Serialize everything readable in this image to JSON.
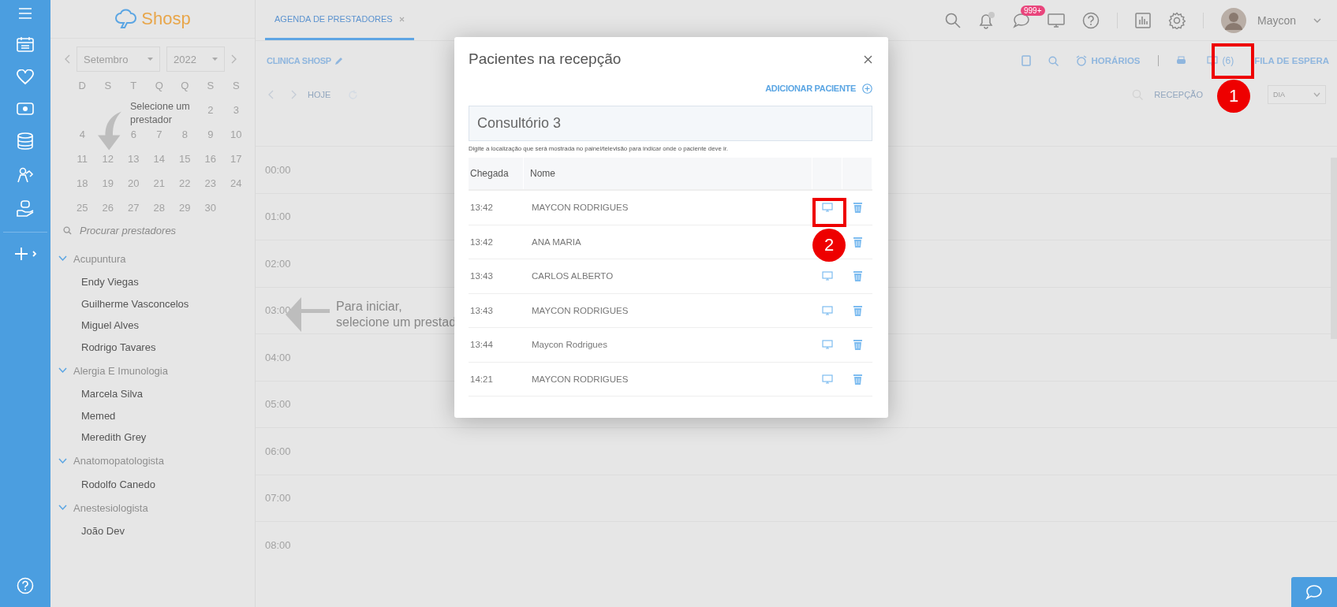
{
  "logo": {
    "text": "Shosp"
  },
  "calendar": {
    "month": "Setembro",
    "year": "2022",
    "weekdays": [
      "D",
      "S",
      "T",
      "Q",
      "Q",
      "S",
      "S"
    ],
    "weeks": [
      [
        {
          "kind": "blank"
        },
        {
          "kind": "blank"
        },
        {
          "kind": "blank"
        },
        {
          "kind": "blank"
        },
        {
          "kind": "blank"
        },
        {
          "kind": "day",
          "day": "2"
        },
        {
          "kind": "day",
          "day": "3"
        }
      ],
      [
        {
          "kind": "day",
          "day": "4"
        },
        {
          "kind": "blank"
        },
        {
          "kind": "day",
          "day": "6"
        },
        {
          "kind": "day",
          "day": "7"
        },
        {
          "kind": "day",
          "day": "8"
        },
        {
          "kind": "day",
          "day": "9"
        },
        {
          "kind": "day",
          "day": "10"
        }
      ],
      [
        {
          "kind": "day",
          "day": "11"
        },
        {
          "kind": "day",
          "day": "12"
        },
        {
          "kind": "day",
          "day": "13"
        },
        {
          "kind": "day",
          "day": "14"
        },
        {
          "kind": "day",
          "day": "15"
        },
        {
          "kind": "day",
          "day": "16"
        },
        {
          "kind": "day",
          "day": "17"
        }
      ],
      [
        {
          "kind": "day",
          "day": "18"
        },
        {
          "kind": "day",
          "day": "19"
        },
        {
          "kind": "day",
          "day": "20"
        },
        {
          "kind": "day",
          "day": "21"
        },
        {
          "kind": "day",
          "day": "22"
        },
        {
          "kind": "day",
          "day": "23"
        },
        {
          "kind": "day",
          "day": "24"
        }
      ],
      [
        {
          "kind": "day",
          "day": "25"
        },
        {
          "kind": "day",
          "day": "26"
        },
        {
          "kind": "day",
          "day": "27"
        },
        {
          "kind": "day",
          "day": "28"
        },
        {
          "kind": "day",
          "day": "29"
        },
        {
          "kind": "day",
          "day": "30"
        },
        {
          "kind": "blank"
        }
      ]
    ],
    "hint": "Selecione um prestador"
  },
  "provider_search": {
    "placeholder": "Procurar prestadores"
  },
  "groups": [
    {
      "label": "Acupuntura",
      "expanded": true,
      "children": [
        {
          "label": "Endy Viegas"
        },
        {
          "label": "Guilherme Vasconcelos"
        },
        {
          "label": "Miguel Alves"
        },
        {
          "label": "Rodrigo Tavares"
        }
      ]
    },
    {
      "label": "Alergia E Imunologia",
      "expanded": true,
      "children": [
        {
          "label": "Marcela Silva"
        },
        {
          "label": "Memed"
        },
        {
          "label": "Meredith Grey"
        }
      ]
    },
    {
      "label": "Anatomopatologista",
      "expanded": true,
      "children": [
        {
          "label": "Rodolfo Canedo"
        }
      ]
    },
    {
      "label": "Anestesiologista",
      "expanded": true,
      "children": [
        {
          "label": "João Dev"
        }
      ]
    }
  ],
  "tabs": [
    {
      "label": "AGENDA DE PRESTADORES",
      "selected": true
    }
  ],
  "header": {
    "messages_badge": "999+",
    "user_name": "Maycon"
  },
  "toolbar": {
    "clinic": "CLINICA SHOSP",
    "schedules": "HORÁRIOS",
    "reception_count": "(6)",
    "waiting_list": "FILA DE ESPERA",
    "today": "HOJE",
    "reception": "RECEPÇÃO",
    "view": "DIA"
  },
  "hours": [
    "00:00",
    "01:00",
    "02:00",
    "03:00",
    "04:00",
    "05:00",
    "06:00",
    "07:00",
    "08:00"
  ],
  "start_hint": {
    "line_1": "Para iniciar,",
    "line_2": "selecione um prestad"
  },
  "modal": {
    "title": "Pacientes na recepção",
    "add_label": "ADICIONAR PACIENTE",
    "location": {
      "value": "Consultório 3"
    },
    "help": "Digite a localização que será mostrada no painel/televisão para indicar onde o paciente deve ir.",
    "columns": [
      "Chegada",
      "Nome"
    ],
    "rows": [
      {
        "time": "13:42",
        "name": "MAYCON RODRIGUES"
      },
      {
        "time": "13:42",
        "name": "ANA MARIA"
      },
      {
        "time": "13:43",
        "name": "CARLOS ALBERTO"
      },
      {
        "time": "13:43",
        "name": "MAYCON RODRIGUES"
      },
      {
        "time": "13:44",
        "name": "Maycon Rodrigues"
      },
      {
        "time": "14:21",
        "name": "MAYCON RODRIGUES"
      }
    ]
  },
  "annotations": [
    {
      "label": "1"
    },
    {
      "label": "2"
    }
  ]
}
